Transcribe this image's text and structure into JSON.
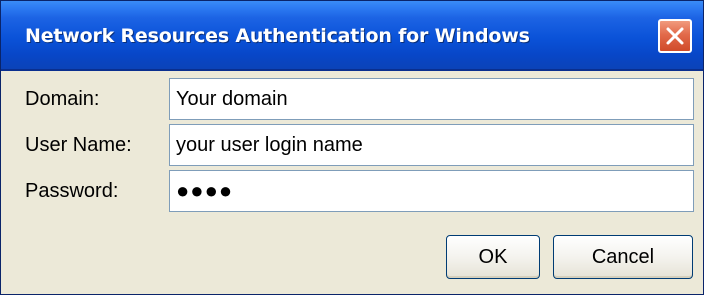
{
  "window": {
    "title": "Network Resources Authentication for Windows",
    "close_icon": "close-icon"
  },
  "form": {
    "domain": {
      "label": "Domain:",
      "value": "Your domain"
    },
    "username": {
      "label": "User Name:",
      "value": "your user login name"
    },
    "password": {
      "label": "Password:",
      "masked_value": "●●●●"
    }
  },
  "buttons": {
    "ok_label": "OK",
    "cancel_label": "Cancel"
  },
  "colors": {
    "titlebar": "#0a52d8",
    "dialog_background": "#ece9d8",
    "close_button": "#e26a4a",
    "input_border": "#7f9db9",
    "button_border": "#003c74"
  }
}
